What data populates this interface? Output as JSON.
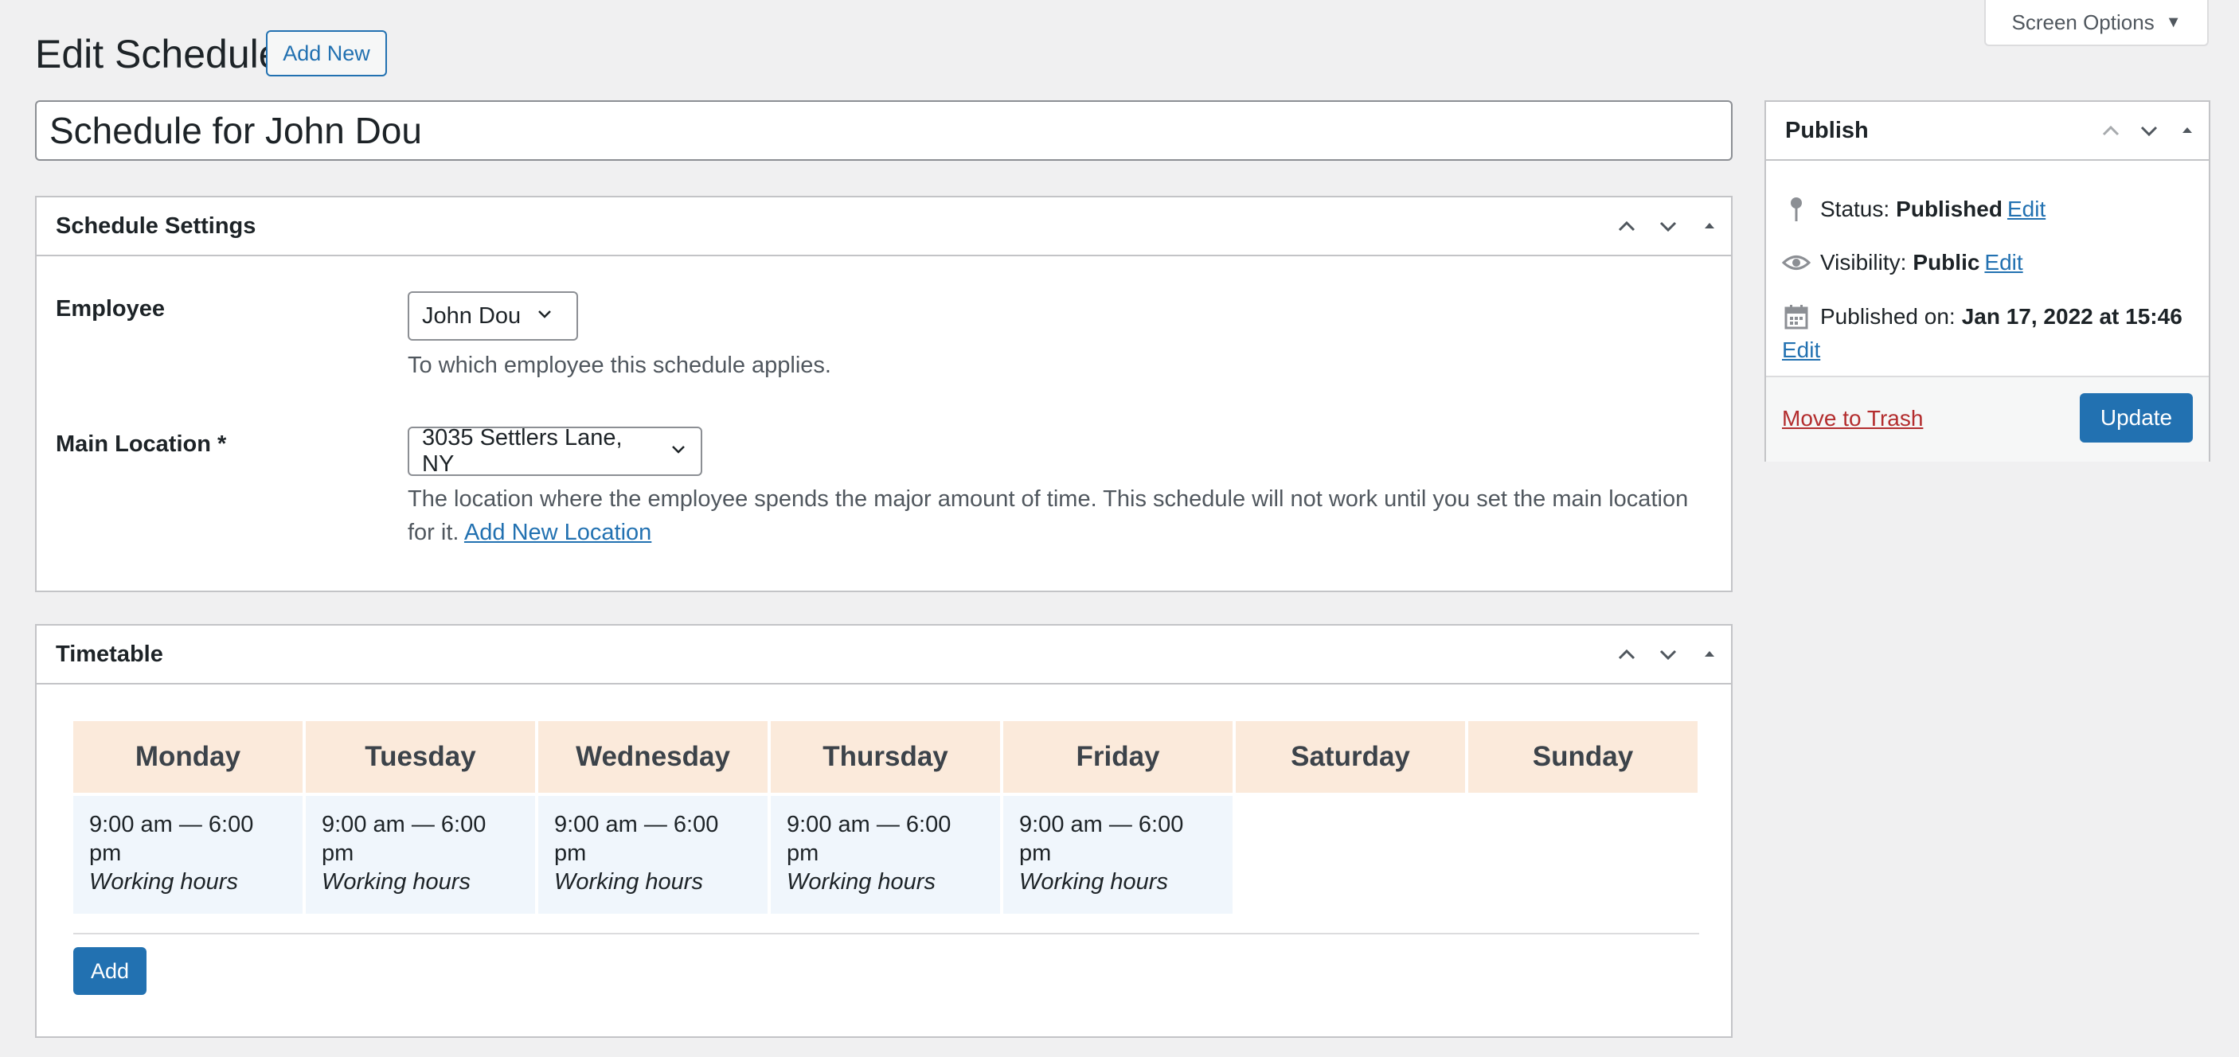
{
  "screen_options": {
    "label": "Screen Options"
  },
  "header": {
    "title": "Edit Schedule",
    "add_new": "Add New"
  },
  "title_field": {
    "value": "Schedule for John Dou"
  },
  "settings": {
    "title": "Schedule Settings",
    "employee": {
      "label": "Employee",
      "selected": "John Dou",
      "description": "To which employee this schedule applies."
    },
    "location": {
      "label": "Main Location *",
      "selected": "3035 Settlers Lane, NY",
      "description": "The location where the employee spends the major amount of time. This schedule will not work until you set the main location for it.",
      "link": "Add New Location"
    }
  },
  "timetable": {
    "title": "Timetable",
    "days": [
      "Monday",
      "Tuesday",
      "Wednesday",
      "Thursday",
      "Friday",
      "Saturday",
      "Sunday"
    ],
    "entries": [
      {
        "time": "9:00 am — 6:00 pm",
        "type": "Working hours"
      },
      {
        "time": "9:00 am — 6:00 pm",
        "type": "Working hours"
      },
      {
        "time": "9:00 am — 6:00 pm",
        "type": "Working hours"
      },
      {
        "time": "9:00 am — 6:00 pm",
        "type": "Working hours"
      },
      {
        "time": "9:00 am — 6:00 pm",
        "type": "Working hours"
      }
    ],
    "add_button": "Add"
  },
  "publish": {
    "title": "Publish",
    "status_label": "Status:",
    "status_value": "Published",
    "visibility_label": "Visibility:",
    "visibility_value": "Public",
    "published_label": "Published on:",
    "published_value": "Jan 17, 2022 at 15:46",
    "edit": "Edit",
    "trash": "Move to Trash",
    "update": "Update"
  },
  "colors": {
    "primary": "#2271b1",
    "header_cell": "#fbeadb",
    "entry_cell": "#f0f6fc",
    "trash": "#b32d2e"
  }
}
